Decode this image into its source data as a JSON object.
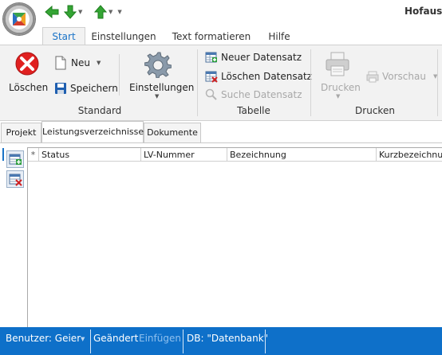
{
  "window": {
    "title": "Hofausb"
  },
  "ribbon_tabs": [
    "Start",
    "Einstellungen",
    "Text formatieren",
    "Hilfe"
  ],
  "ribbon": {
    "standard": {
      "label": "Standard",
      "loeschen": "Löschen",
      "neu": "Neu",
      "speichern": "Speichern",
      "einstellungen": "Einstellungen"
    },
    "tabelle": {
      "label": "Tabelle",
      "neuer": "Neuer Datensatz",
      "loeschen": "Löschen Datensatz",
      "suche": "Suche Datensatz"
    },
    "drucken": {
      "label": "Drucken",
      "drucken": "Drucken",
      "vorschau": "Vorschau"
    }
  },
  "content_tabs": [
    "Projekt",
    "Leistungsverzeichnisse",
    "Dokumente"
  ],
  "grid": {
    "new_row_marker": "*",
    "columns": [
      "Status",
      "LV-Nummer",
      "Bezeichnung",
      "Kurzbezeichnung"
    ]
  },
  "status": {
    "user": "Benutzer: Geier",
    "changed": "Geändert",
    "insert": "Einfügen",
    "db": "DB: \"Datenbank\""
  },
  "colors": {
    "accent": "#0e70c9",
    "tab_active": "#1a73c7",
    "delete_red": "#e02020",
    "qat_green": "#2f9e2f"
  },
  "icons": [
    "app-logo",
    "arrow-left-icon",
    "arrow-down-icon",
    "arrow-up-icon",
    "delete-icon",
    "new-document-icon",
    "save-icon",
    "gear-icon",
    "new-record-icon",
    "delete-record-icon",
    "search-icon",
    "printer-icon",
    "preview-icon"
  ]
}
